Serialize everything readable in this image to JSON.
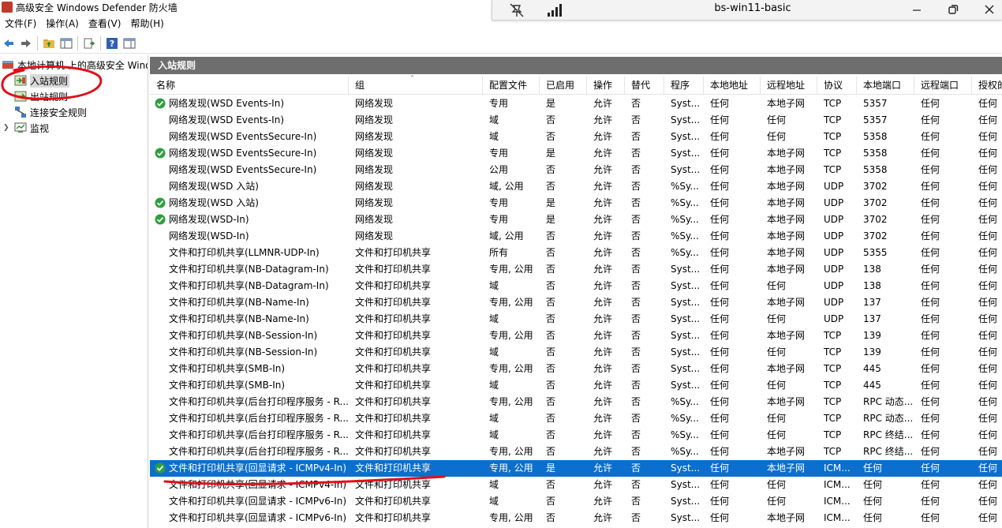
{
  "window": {
    "title": "高级安全 Windows Defender 防火墙"
  },
  "remote": {
    "name": "bs-win11-basic"
  },
  "menu": [
    "文件(F)",
    "操作(A)",
    "查看(V)",
    "帮助(H)"
  ],
  "tree": {
    "root": "本地计算机 上的高级安全 Windows Defender 防火墙",
    "inbound": "入站规则",
    "outbound": "出站规则",
    "connection": "连接安全规则",
    "monitor": "监视"
  },
  "pane_title": "入站规则",
  "columns": [
    "名称",
    "组",
    "配置文件",
    "已启用",
    "操作",
    "替代",
    "程序",
    "本地地址",
    "远程地址",
    "协议",
    "本地端口",
    "远程端口",
    "授权的"
  ],
  "rows": [
    {
      "enabled_icon": true,
      "cells": [
        "网络发现(WSD Events-In)",
        "网络发现",
        "专用",
        "是",
        "允许",
        "否",
        "Syst...",
        "任何",
        "本地子网",
        "TCP",
        "5357",
        "任何",
        "任何"
      ]
    },
    {
      "enabled_icon": false,
      "cells": [
        "网络发现(WSD Events-In)",
        "网络发现",
        "域",
        "否",
        "允许",
        "否",
        "Syst...",
        "任何",
        "任何",
        "TCP",
        "5357",
        "任何",
        "任何"
      ]
    },
    {
      "enabled_icon": false,
      "cells": [
        "网络发现(WSD EventsSecure-In)",
        "网络发现",
        "域",
        "否",
        "允许",
        "否",
        "Syst...",
        "任何",
        "任何",
        "TCP",
        "5358",
        "任何",
        "任何"
      ]
    },
    {
      "enabled_icon": true,
      "cells": [
        "网络发现(WSD EventsSecure-In)",
        "网络发现",
        "专用",
        "是",
        "允许",
        "否",
        "Syst...",
        "任何",
        "本地子网",
        "TCP",
        "5358",
        "任何",
        "任何"
      ]
    },
    {
      "enabled_icon": false,
      "cells": [
        "网络发现(WSD EventsSecure-In)",
        "网络发现",
        "公用",
        "否",
        "允许",
        "否",
        "Syst...",
        "任何",
        "本地子网",
        "TCP",
        "5358",
        "任何",
        "任何"
      ]
    },
    {
      "enabled_icon": false,
      "cells": [
        "网络发现(WSD 入站)",
        "网络发现",
        "域, 公用",
        "否",
        "允许",
        "否",
        "%Sy...",
        "任何",
        "本地子网",
        "UDP",
        "3702",
        "任何",
        "任何"
      ]
    },
    {
      "enabled_icon": true,
      "cells": [
        "网络发现(WSD 入站)",
        "网络发现",
        "专用",
        "是",
        "允许",
        "否",
        "%Sy...",
        "任何",
        "本地子网",
        "UDP",
        "3702",
        "任何",
        "任何"
      ]
    },
    {
      "enabled_icon": true,
      "cells": [
        "网络发现(WSD-In)",
        "网络发现",
        "专用",
        "是",
        "允许",
        "否",
        "%Sy...",
        "任何",
        "本地子网",
        "UDP",
        "3702",
        "任何",
        "任何"
      ]
    },
    {
      "enabled_icon": false,
      "cells": [
        "网络发现(WSD-In)",
        "网络发现",
        "域, 公用",
        "否",
        "允许",
        "否",
        "%Sy...",
        "任何",
        "本地子网",
        "UDP",
        "3702",
        "任何",
        "任何"
      ]
    },
    {
      "enabled_icon": false,
      "cells": [
        "文件和打印机共享(LLMNR-UDP-In)",
        "文件和打印机共享",
        "所有",
        "否",
        "允许",
        "否",
        "%Sy...",
        "任何",
        "本地子网",
        "UDP",
        "5355",
        "任何",
        "任何"
      ]
    },
    {
      "enabled_icon": false,
      "cells": [
        "文件和打印机共享(NB-Datagram-In)",
        "文件和打印机共享",
        "专用, 公用",
        "否",
        "允许",
        "否",
        "Syst...",
        "任何",
        "本地子网",
        "UDP",
        "138",
        "任何",
        "任何"
      ]
    },
    {
      "enabled_icon": false,
      "cells": [
        "文件和打印机共享(NB-Datagram-In)",
        "文件和打印机共享",
        "域",
        "否",
        "允许",
        "否",
        "Syst...",
        "任何",
        "任何",
        "UDP",
        "138",
        "任何",
        "任何"
      ]
    },
    {
      "enabled_icon": false,
      "cells": [
        "文件和打印机共享(NB-Name-In)",
        "文件和打印机共享",
        "专用, 公用",
        "否",
        "允许",
        "否",
        "Syst...",
        "任何",
        "本地子网",
        "UDP",
        "137",
        "任何",
        "任何"
      ]
    },
    {
      "enabled_icon": false,
      "cells": [
        "文件和打印机共享(NB-Name-In)",
        "文件和打印机共享",
        "域",
        "否",
        "允许",
        "否",
        "Syst...",
        "任何",
        "任何",
        "UDP",
        "137",
        "任何",
        "任何"
      ]
    },
    {
      "enabled_icon": false,
      "cells": [
        "文件和打印机共享(NB-Session-In)",
        "文件和打印机共享",
        "专用, 公用",
        "否",
        "允许",
        "否",
        "Syst...",
        "任何",
        "本地子网",
        "TCP",
        "139",
        "任何",
        "任何"
      ]
    },
    {
      "enabled_icon": false,
      "cells": [
        "文件和打印机共享(NB-Session-In)",
        "文件和打印机共享",
        "域",
        "否",
        "允许",
        "否",
        "Syst...",
        "任何",
        "任何",
        "TCP",
        "139",
        "任何",
        "任何"
      ]
    },
    {
      "enabled_icon": false,
      "cells": [
        "文件和打印机共享(SMB-In)",
        "文件和打印机共享",
        "专用, 公用",
        "否",
        "允许",
        "否",
        "Syst...",
        "任何",
        "本地子网",
        "TCP",
        "445",
        "任何",
        "任何"
      ]
    },
    {
      "enabled_icon": false,
      "cells": [
        "文件和打印机共享(SMB-In)",
        "文件和打印机共享",
        "域",
        "否",
        "允许",
        "否",
        "Syst...",
        "任何",
        "任何",
        "TCP",
        "445",
        "任何",
        "任何"
      ]
    },
    {
      "enabled_icon": false,
      "cells": [
        "文件和打印机共享(后台打印程序服务 - R...",
        "文件和打印机共享",
        "专用, 公用",
        "否",
        "允许",
        "否",
        "%Sy...",
        "任何",
        "本地子网",
        "TCP",
        "RPC 动态...",
        "任何",
        "任何"
      ]
    },
    {
      "enabled_icon": false,
      "cells": [
        "文件和打印机共享(后台打印程序服务 - R...",
        "文件和打印机共享",
        "域",
        "否",
        "允许",
        "否",
        "%Sy...",
        "任何",
        "任何",
        "TCP",
        "RPC 动态...",
        "任何",
        "任何"
      ]
    },
    {
      "enabled_icon": false,
      "cells": [
        "文件和打印机共享(后台打印程序服务 - R...",
        "文件和打印机共享",
        "域",
        "否",
        "允许",
        "否",
        "%Sy...",
        "任何",
        "任何",
        "TCP",
        "RPC 终结...",
        "任何",
        "任何"
      ]
    },
    {
      "enabled_icon": false,
      "cells": [
        "文件和打印机共享(后台打印程序服务 - R...",
        "文件和打印机共享",
        "专用, 公用",
        "否",
        "允许",
        "否",
        "%Sy...",
        "任何",
        "本地子网",
        "TCP",
        "RPC 终结...",
        "任何",
        "任何"
      ]
    },
    {
      "enabled_icon": true,
      "selected": true,
      "cells": [
        "文件和打印机共享(回显请求 - ICMPv4-In)",
        "文件和打印机共享",
        "专用, 公用",
        "是",
        "允许",
        "否",
        "Syst...",
        "任何",
        "本地子网",
        "ICM...",
        "任何",
        "任何",
        "任何"
      ]
    },
    {
      "enabled_icon": false,
      "cells": [
        "文件和打印机共享(回显请求 - ICMPv4-In)",
        "文件和打印机共享",
        "域",
        "否",
        "允许",
        "否",
        "Syst...",
        "任何",
        "任何",
        "ICM...",
        "任何",
        "任何",
        "任何"
      ]
    },
    {
      "enabled_icon": false,
      "cells": [
        "文件和打印机共享(回显请求 - ICMPv6-In)",
        "文件和打印机共享",
        "域",
        "否",
        "允许",
        "否",
        "Syst...",
        "任何",
        "任何",
        "ICM...",
        "任何",
        "任何",
        "任何"
      ]
    },
    {
      "enabled_icon": false,
      "cells": [
        "文件和打印机共享(回显请求 - ICMPv6-In)",
        "文件和打印机共享",
        "专用, 公用",
        "否",
        "允许",
        "否",
        "Syst...",
        "任何",
        "本地子网",
        "ICM...",
        "任何",
        "任何",
        "任何"
      ]
    }
  ],
  "colors": {
    "selected": "#0a6fce",
    "pane_header": "#6e6e6e",
    "annotation": "#e0101a",
    "enabled_check": "#2e9e3e"
  }
}
